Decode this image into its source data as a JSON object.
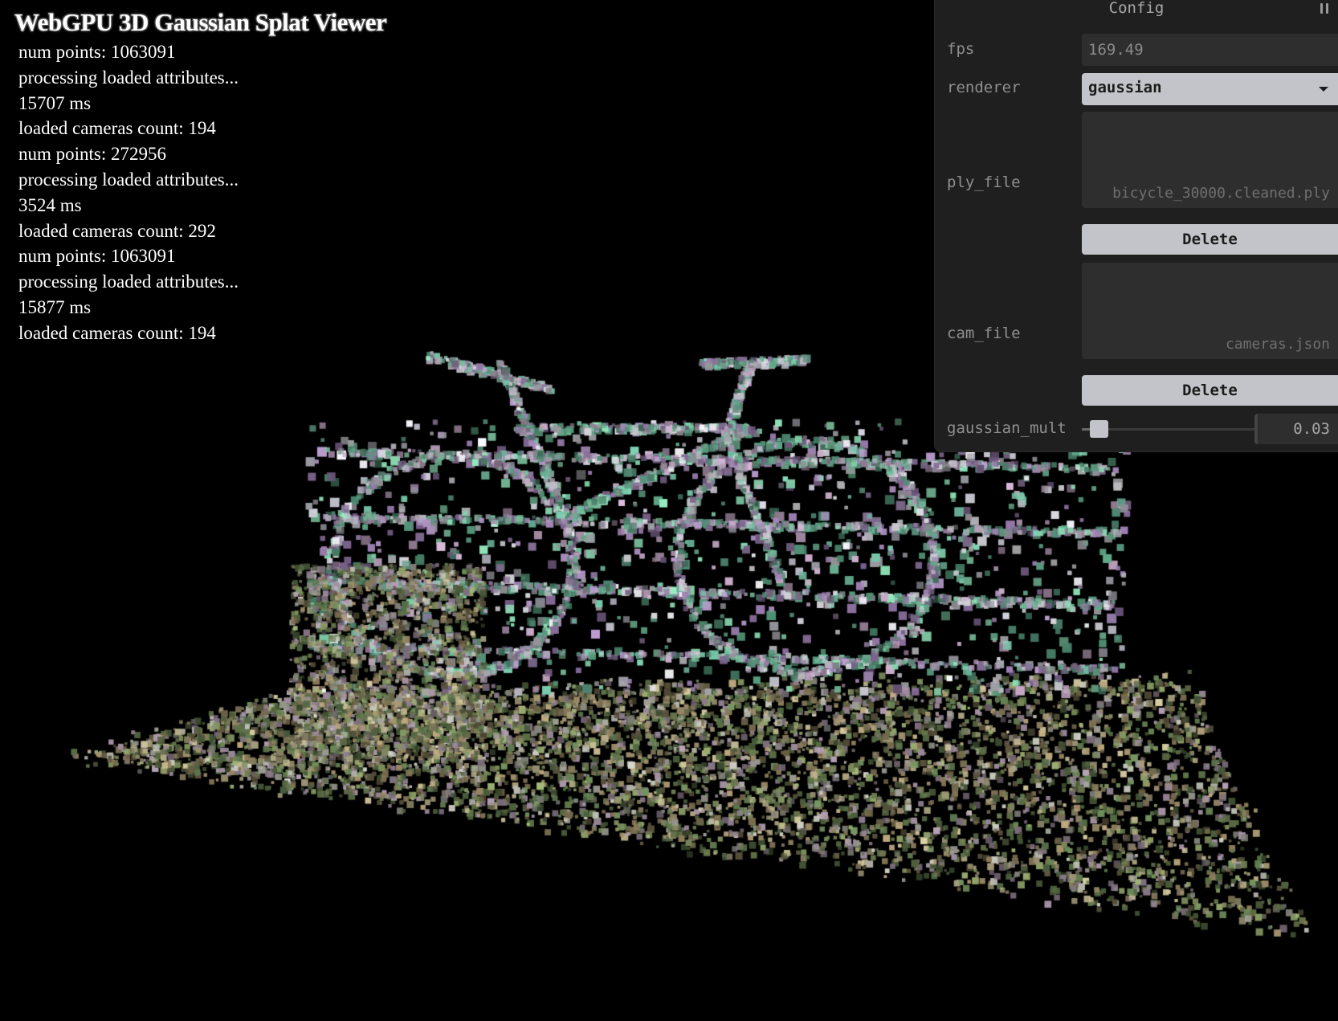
{
  "app": {
    "title": "WebGPU 3D Gaussian Splat Viewer"
  },
  "log": [
    "num points: 1063091",
    "processing loaded attributes...",
    "15707 ms",
    "loaded cameras count: 194",
    "num points: 272956",
    "processing loaded attributes...",
    "3524 ms",
    "loaded cameras count: 292",
    "num points: 1063091",
    "processing loaded attributes...",
    "15877 ms",
    "loaded cameras count: 194"
  ],
  "config": {
    "title": "Config",
    "collapse_icon": "pause-bars-icon",
    "fps": {
      "label": "fps",
      "value": "169.49"
    },
    "renderer": {
      "label": "renderer",
      "value": "gaussian",
      "icon": "caret-down-icon"
    },
    "ply_file": {
      "label": "ply_file",
      "file_name": "bicycle_30000.cleaned.ply",
      "delete_label": "Delete"
    },
    "cam_file": {
      "label": "cam_file",
      "file_name": "cameras.json",
      "delete_label": "Delete"
    },
    "gaussian_mult": {
      "label": "gaussian_mult",
      "value": "0.03",
      "level": 0.03
    }
  },
  "colors": {
    "background": "#000000",
    "panel_bg": "#1f1f1f",
    "field_bg": "#2e2e2e",
    "button_bg": "#c3c4c9",
    "label_text": "#8f8f8f"
  }
}
